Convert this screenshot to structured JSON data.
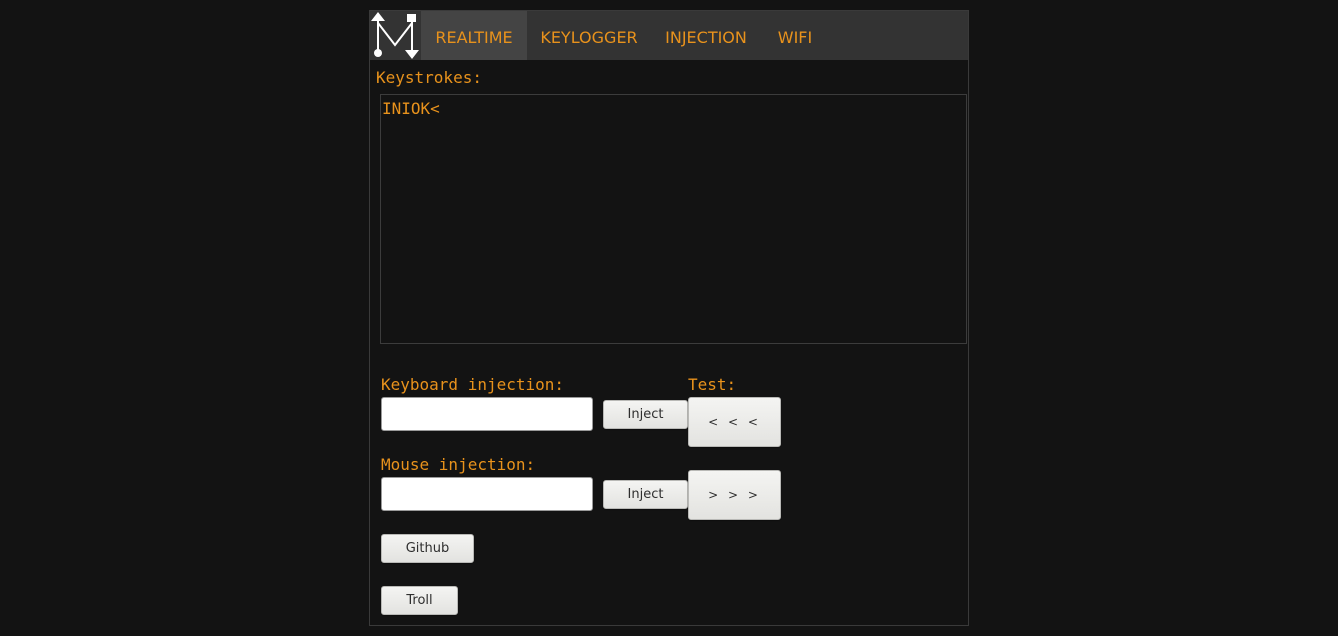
{
  "nav": {
    "items": [
      {
        "label": "REALTIME"
      },
      {
        "label": "KEYLOGGER"
      },
      {
        "label": "INJECTION"
      },
      {
        "label": "WIFI"
      }
    ]
  },
  "keystrokes": {
    "label": "Keystrokes:",
    "content": "INIOK<"
  },
  "keyboard_injection": {
    "label": "Keyboard injection:",
    "value": "",
    "button": "Inject"
  },
  "mouse_injection": {
    "label": "Mouse injection:",
    "value": "",
    "button": "Inject"
  },
  "test": {
    "label": "Test:",
    "prev_button": "< < <",
    "next_button": "> > >"
  },
  "links": {
    "github": "Github",
    "troll": "Troll"
  },
  "colors": {
    "accent": "#e8921c",
    "background": "#131313",
    "navbar": "#333333"
  }
}
